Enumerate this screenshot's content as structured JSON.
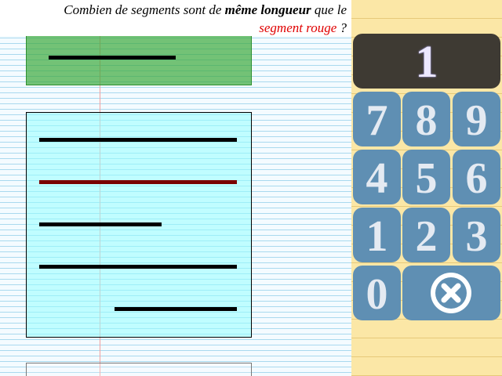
{
  "question": {
    "part1": "Combien de segments sont de ",
    "bold": "même longueur",
    "part2": " que le",
    "red": "segment rouge",
    "part3": " ?"
  },
  "display": {
    "value": "1"
  },
  "keypad": {
    "keys": [
      "7",
      "8",
      "9",
      "4",
      "5",
      "6",
      "1",
      "2",
      "3",
      "0"
    ],
    "clear_icon": "close-circle-icon"
  },
  "colors": {
    "reference_box": "#46ad46",
    "choice_box": "#b4ffff",
    "red_segment": "#7a0000",
    "key": "#5f8fb3",
    "display": "#3e3a33",
    "keypad_paper": "#fbe7a6"
  }
}
